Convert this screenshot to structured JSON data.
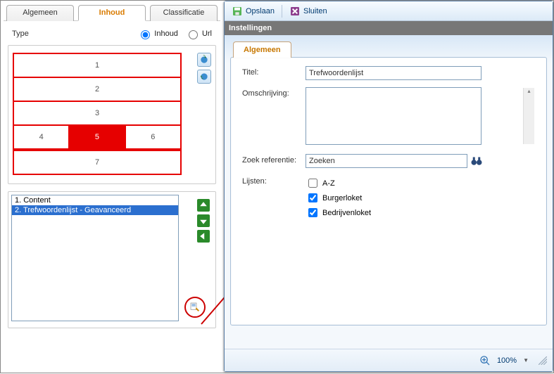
{
  "outer_tabs": {
    "t0": "Algemeen",
    "t1": "Inhoud",
    "t2": "Classificatie"
  },
  "type": {
    "label": "Type",
    "opt_inhoud": "Inhoud",
    "opt_url": "Url"
  },
  "layout_cells": {
    "c1": "1",
    "c2": "2",
    "c3": "3",
    "c4": "4",
    "c5": "5",
    "c6": "6",
    "c7": "7"
  },
  "list": {
    "item1": "1. Content",
    "item2": "2. Trefwoordenlijst - Geavanceerd"
  },
  "dialog": {
    "toolbar": {
      "save": "Opslaan",
      "close": "Sluiten"
    },
    "title": "Instellingen",
    "tab": "Algemeen",
    "fields": {
      "titel_label": "Titel:",
      "titel_value": "Trefwoordenlijst",
      "omschr_label": "Omschrijving:",
      "zoek_label": "Zoek referentie:",
      "zoek_value": "Zoeken",
      "lijsten_label": "Lijsten:",
      "cb_az": "A-Z",
      "cb_burger": "Burgerloket",
      "cb_bedrijf": "Bedrijvenloket"
    },
    "zoom": "100%"
  }
}
